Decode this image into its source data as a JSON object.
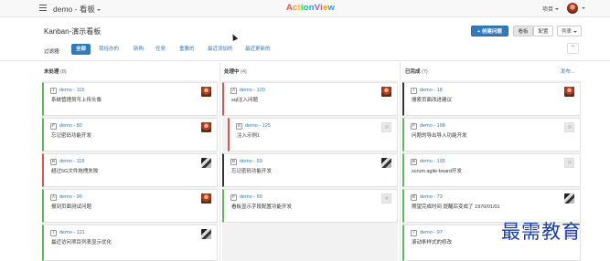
{
  "topbar": {
    "project_name": "demo - 看板",
    "brand": [
      "A",
      "c",
      "t",
      "i",
      "o",
      "n",
      "V",
      "i",
      "e",
      "w"
    ],
    "brand_colors": [
      "#e84c3d",
      "#f39c12",
      "#f1c40f",
      "#2ecc71",
      "#1abc9c",
      "#3498db",
      "#9b59b6",
      "#e84c3d",
      "#f39c12",
      "#3498db"
    ],
    "menu_project": "项目"
  },
  "board": {
    "title": "Kanban-演示看板",
    "create_button": "+ 创建问题",
    "view_kanban": "看板",
    "view_config": "配置",
    "view_list": "列表"
  },
  "filters": {
    "label": "过滤器:",
    "items": [
      "全部",
      "我经办的",
      "新购",
      "任务",
      "重要的",
      "最近添加的",
      "最近更新的"
    ]
  },
  "columns": [
    {
      "name": "未处理",
      "count": "(8)"
    },
    {
      "name": "处理中",
      "count": "(4)"
    },
    {
      "name": "已完成",
      "count": "(7)",
      "link": "发布..."
    }
  ],
  "cards": {
    "col1": [
      {
        "type": "I",
        "no": "demo - 115",
        "title": "系统管理员可上传头像",
        "avatar": "person"
      },
      {
        "type": "F",
        "no": "demo - 80",
        "title": "忘记密码功能开发",
        "avatar": "person"
      },
      {
        "type": "B",
        "no": "demo - 118",
        "title": "超过5G文件拖拽失败",
        "avatar": "bw"
      },
      {
        "type": "A",
        "no": "demo - 96",
        "title": "报到页面测试问题",
        "avatar": "person"
      },
      {
        "type": "I",
        "no": "demo - 121",
        "title": "最近访问项目列表显示优化",
        "avatar": "bw"
      }
    ],
    "col2": [
      {
        "type": "A",
        "no": "demo - 120",
        "title": "sql注入问题",
        "avatar": "person"
      },
      {
        "type": "S",
        "no": "demo - 125",
        "title": "注入示例1",
        "avatar": "blank"
      },
      {
        "type": "B",
        "no": "demo - 59",
        "title": "忘记密码功能开发",
        "avatar": "bw"
      },
      {
        "type": "F",
        "no": "demo - 69",
        "title": "看板显示字段配置功能开发",
        "avatar": "blank"
      }
    ],
    "col3": [
      {
        "type": "I",
        "no": "demo - 18",
        "title": "搜索页面改进建议",
        "avatar": "person"
      },
      {
        "type": "F",
        "no": "demo - 108",
        "title": "问题的导出导入功能开发",
        "avatar": "blank"
      },
      {
        "type": "B",
        "no": "demo - 105",
        "title": "scrum agile-board开发",
        "avatar": "blank"
      },
      {
        "type": "B",
        "no": "demo - 73",
        "title": "期望完成时间 提醒后变成了 1970/01/01",
        "avatar": "bw"
      },
      {
        "type": "I",
        "no": "demo - 97",
        "title": "滚动条样式的修改",
        "avatar": "blank"
      }
    ]
  },
  "watermark": "最需教育"
}
